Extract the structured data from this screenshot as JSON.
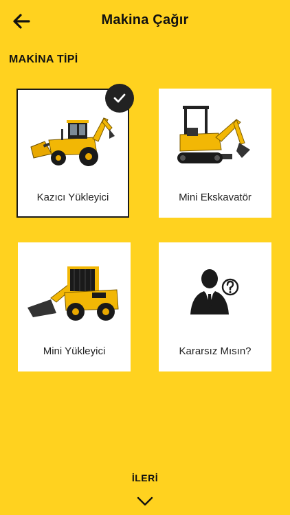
{
  "header": {
    "title": "Makina Çağır",
    "back_icon": "arrow-left-icon"
  },
  "section": {
    "label": "MAKİNA TİPİ"
  },
  "machines": [
    {
      "label": "Kazıcı Yükleyici",
      "icon": "backhoe-loader-image",
      "selected": true
    },
    {
      "label": "Mini Ekskavatör",
      "icon": "mini-excavator-image",
      "selected": false
    },
    {
      "label": "Mini Yükleyici",
      "icon": "skid-steer-loader-image",
      "selected": false
    },
    {
      "label": "Kararsız Mısın?",
      "icon": "undecided-person-icon",
      "selected": false
    }
  ],
  "footer": {
    "next_label": "İLERİ",
    "next_icon": "chevron-down-icon"
  },
  "colors": {
    "background": "#FFD21F",
    "card": "#FFFFFF",
    "accent": "#F2B705",
    "dark": "#1A1A1A"
  }
}
